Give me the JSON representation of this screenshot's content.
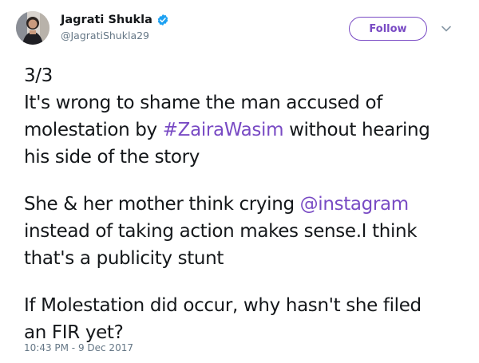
{
  "user": {
    "display_name": "Jagrati Shukla",
    "handle": "@JagratiShukla29",
    "verified": true
  },
  "follow_button": {
    "label": "Follow"
  },
  "tweet": {
    "line1": "3/3",
    "line2": "It's wrong to shame the man accused of",
    "line3_prefix": "molestation by ",
    "hashtag": "#ZairaWasim",
    "line3_suffix": " without hearing",
    "line4": "his side of the story",
    "line5_prefix": "She & her mother think crying ",
    "mention": "@instagram",
    "line6": "instead of taking action makes sense.I think",
    "line7": "that's a publicity stunt",
    "line8": "If Molestation did occur, why hasn't she filed",
    "line9": "an FIR yet?"
  },
  "timestamp": "10:43 PM - 9 Dec 2017",
  "colors": {
    "accent": "#794bc4",
    "verified_badge": "#1da1f2",
    "secondary_text": "#657786",
    "primary_text": "#14171a"
  },
  "icons": {
    "verified": "verified-badge-icon",
    "more": "chevron-down-icon"
  }
}
